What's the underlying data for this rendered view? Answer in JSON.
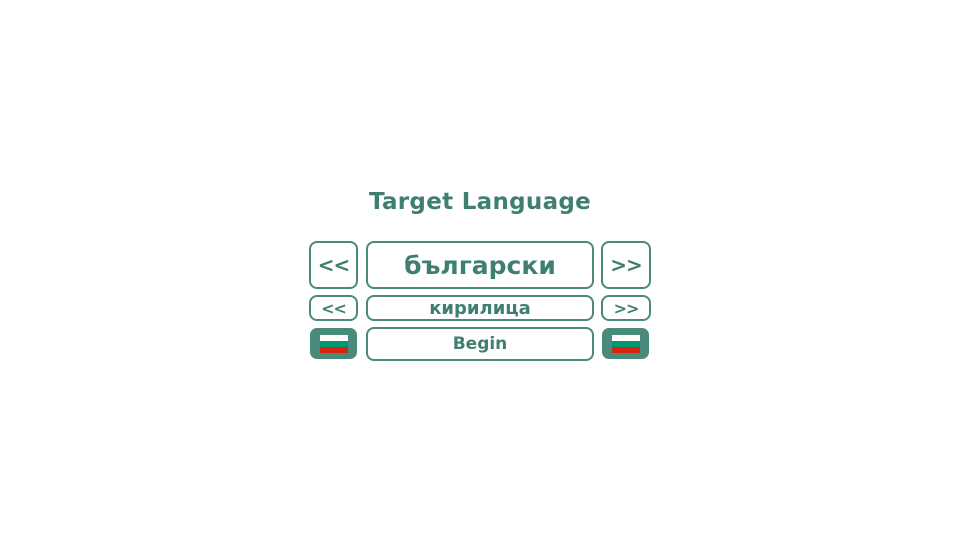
{
  "title": "Target Language",
  "language": {
    "prev_label": "<<",
    "name": "български",
    "next_label": ">>"
  },
  "script": {
    "prev_label": "<<",
    "name": "кирилица",
    "next_label": ">>"
  },
  "begin_label": "Begin",
  "flag": {
    "icon": "bulgarian-flag-icon",
    "stripes": [
      "#ffffff",
      "#00966e",
      "#d62612"
    ]
  },
  "colors": {
    "accent": "#4a8a7c",
    "text": "#3f7f71",
    "background": "#ffffff"
  }
}
